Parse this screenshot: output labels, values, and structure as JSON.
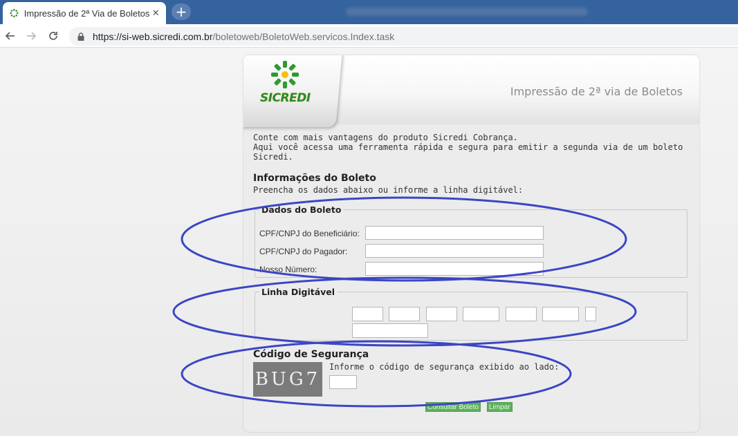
{
  "browser": {
    "tab_title": "Impressão de 2ª Via de Boletos",
    "url_host": "https://si-web.sicredi.com.br",
    "url_path": "/boletoweb/BoletoWeb.servicos.Index.task",
    "new_tab_symbol": "+",
    "close_symbol": "✕",
    "icons": [
      "sicredi-favicon-icon",
      "back-arrow-icon",
      "forward-arrow-icon",
      "reload-icon",
      "lock-icon"
    ]
  },
  "header": {
    "logo_text": "SICREDI",
    "title": "Impressão de 2ª via de Boletos"
  },
  "intro": {
    "line1": "Conte com mais vantagens do produto Sicredi Cobrança.",
    "line2": "Aqui você acessa uma ferramenta rápida e segura para emitir a segunda via de um boleto Sicredi."
  },
  "info": {
    "title": "Informações do Boleto",
    "subtitle": "Preencha os dados abaixo ou informe a linha digitável:"
  },
  "dados": {
    "legend": "Dados do Boleto",
    "fields": [
      {
        "label": "CPF/CNPJ do Beneficiário:",
        "value": ""
      },
      {
        "label": "CPF/CNPJ do Pagador:",
        "value": ""
      },
      {
        "label": "Nosso Número:",
        "value": ""
      }
    ]
  },
  "linha": {
    "legend": "Linha Digitável"
  },
  "seguranca": {
    "title": "Código de Segurança",
    "captcha_text": "BUG7",
    "hint": "Informe o código de segurança exibido ao lado:"
  },
  "buttons": {
    "consultar": "Consultar Boleto",
    "limpar": "Limpar"
  },
  "colors": {
    "tabbar": "#35639d",
    "annotation_ellipse": "#3b46c4",
    "button_green": "#5fae5f",
    "logo_green": "#2c8a2c"
  }
}
